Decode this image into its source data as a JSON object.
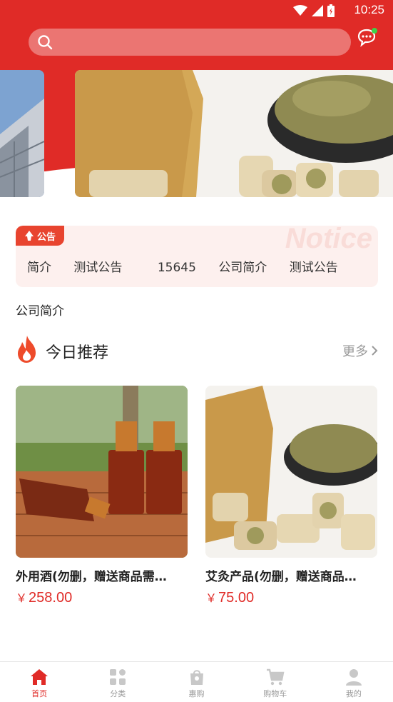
{
  "status_bar": {
    "time": "10:25"
  },
  "search": {
    "placeholder": ""
  },
  "notice": {
    "tag": "公告",
    "watermark": "Notice",
    "items": [
      "简介",
      "测试公告",
      "15645",
      "公司简介",
      "测试公告"
    ]
  },
  "company_intro": "公司简介",
  "recommend": {
    "title": "今日推荐",
    "more": "更多"
  },
  "products": [
    {
      "name": "外用酒(勿删，赠送商品需…",
      "currency": "￥",
      "price": "258.00"
    },
    {
      "name": "艾灸产品(勿删，赠送商品…",
      "currency": "￥",
      "price": "75.00"
    }
  ],
  "tabs": [
    {
      "label": "首页",
      "icon": "home-icon",
      "active": true
    },
    {
      "label": "分类",
      "icon": "grid-icon",
      "active": false
    },
    {
      "label": "惠购",
      "icon": "bag-icon",
      "active": false
    },
    {
      "label": "购物车",
      "icon": "cart-icon",
      "active": false
    },
    {
      "label": "我的",
      "icon": "user-icon",
      "active": false
    }
  ],
  "colors": {
    "brand": "#e02b27",
    "notice_bg": "#fdf0ee",
    "notice_tag": "#e8442f"
  }
}
